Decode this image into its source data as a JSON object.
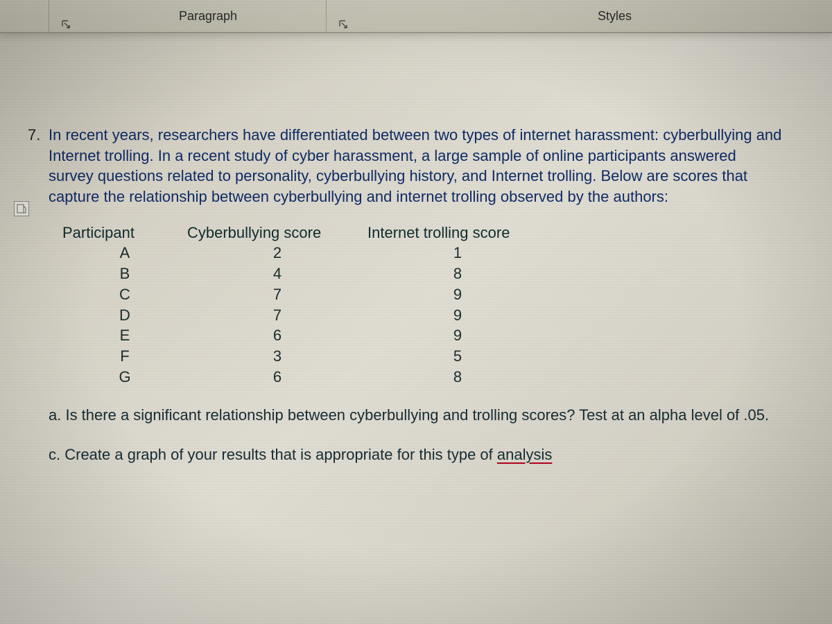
{
  "ribbon": {
    "paragraph_label": "Paragraph",
    "styles_label": "Styles"
  },
  "question": {
    "number": "7.",
    "text": "In recent years, researchers have differentiated between two types of internet harassment: cyberbullying and Internet trolling. In a recent study of cyber harassment, a large sample of online participants answered survey questions related to personality, cyberbullying history, and Internet trolling. Below are scores that capture the relationship between cyberbullying and internet trolling observed by the authors:"
  },
  "table": {
    "headers": {
      "participant": "Participant",
      "cyber": "Cyberbullying score",
      "troll": "Internet trolling score"
    },
    "rows": [
      {
        "p": "A",
        "c": "2",
        "t": "1"
      },
      {
        "p": "B",
        "c": "4",
        "t": "8"
      },
      {
        "p": "C",
        "c": "7",
        "t": "9"
      },
      {
        "p": "D",
        "c": "7",
        "t": "9"
      },
      {
        "p": "E",
        "c": "6",
        "t": "9"
      },
      {
        "p": "F",
        "c": "3",
        "t": "5"
      },
      {
        "p": "G",
        "c": "6",
        "t": "8"
      }
    ]
  },
  "sub_a": "a. Is there a significant relationship between cyberbullying and trolling scores? Test at an alpha level of .05.",
  "sub_c_prefix": "c. Create a graph of your results that is appropriate for this type of ",
  "sub_c_underlined": "analysis"
}
